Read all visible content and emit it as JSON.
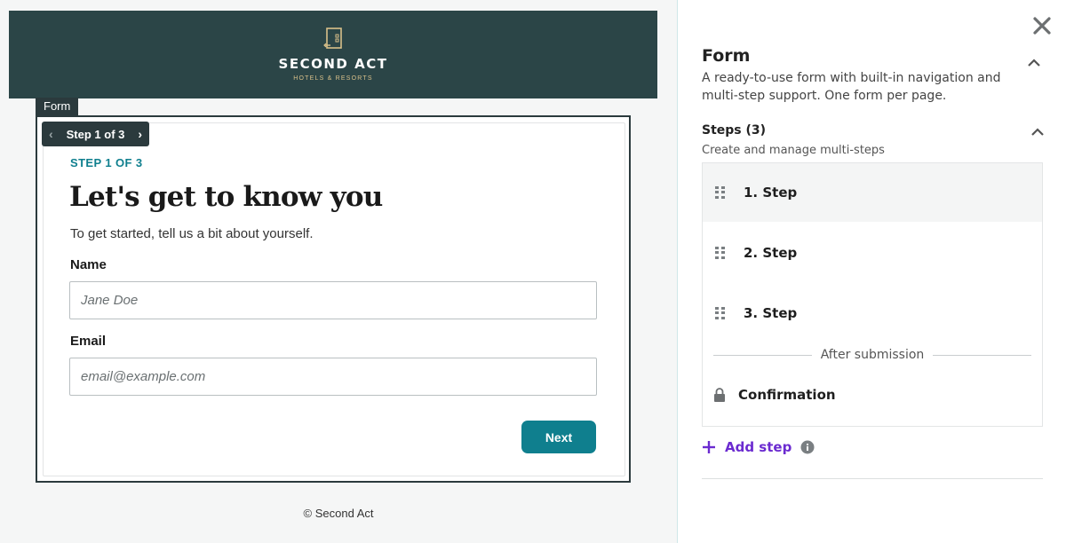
{
  "canvas": {
    "brand": {
      "name": "SECOND ACT",
      "tagline": "HOTELS & RESORTS"
    },
    "form_tag": "Form",
    "step_pill": {
      "label": "Step 1 of 3",
      "prev_icon": "chevron-left-icon",
      "next_icon": "chevron-right-icon"
    },
    "step_label": "STEP 1 OF 3",
    "title": "Let's get to know you",
    "description": "To get started, tell us a bit about yourself.",
    "fields": [
      {
        "label": "Name",
        "placeholder": "Jane Doe",
        "value": ""
      },
      {
        "label": "Email",
        "placeholder": "email@example.com",
        "value": ""
      }
    ],
    "next_button": "Next",
    "footer": "© Second Act"
  },
  "panel": {
    "close_icon": "close-icon",
    "title": "Form",
    "description": "A ready-to-use form with built-in navigation and multi-step support. One form per page.",
    "steps_title": "Steps (3)",
    "steps_subtitle": "Create and manage multi-steps",
    "steps": [
      {
        "label": "1. Step",
        "active": true
      },
      {
        "label": "2. Step",
        "active": false
      },
      {
        "label": "3. Step",
        "active": false
      }
    ],
    "after_submission": "After submission",
    "confirmation": "Confirmation",
    "add_step": "Add step"
  },
  "colors": {
    "hero_bg": "#2b4547",
    "accent_teal": "#0f7f8e",
    "accent_purple": "#6b2bd0",
    "dark_chrome": "#2b3a3d"
  }
}
